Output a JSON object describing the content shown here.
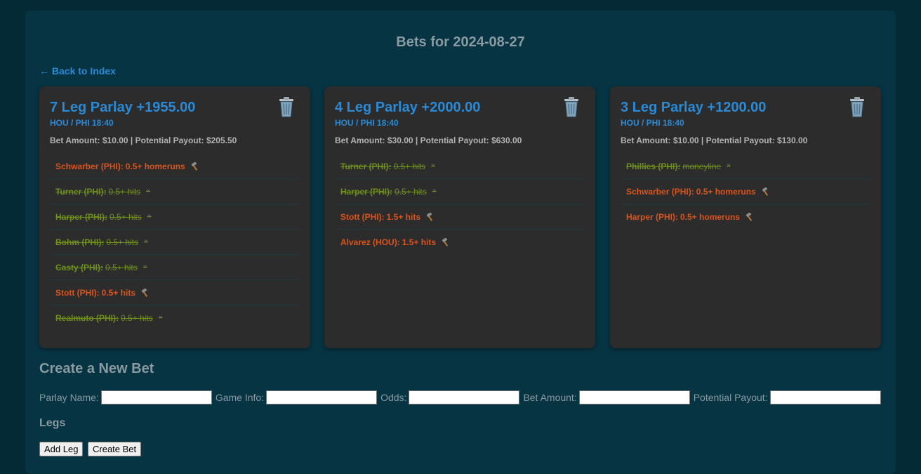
{
  "page": {
    "title": "Bets for 2024-08-27",
    "back_link": "← Back to Index"
  },
  "colors": {
    "accent": "#2a8ad6",
    "pending": "#d9541e",
    "won": "#6f8f1d",
    "card_bg": "#2c2c2c",
    "page_bg": "#063442"
  },
  "cards": [
    {
      "title": "7 Leg Parlay +1955.00",
      "game": "HOU / PHI 18:40",
      "amount": "Bet Amount: $10.00 | Potential Payout: $205.50",
      "legs": [
        {
          "player": "Schwarber (PHI):",
          "prop": "0.5+ homeruns",
          "status": "pending",
          "icon": "hammer-icon"
        },
        {
          "player": "Turner (PHI):",
          "prop": "0.5+ hits",
          "status": "won",
          "mark": "×"
        },
        {
          "player": "Harper (PHI):",
          "prop": "0.5+ hits",
          "status": "won",
          "mark": "×"
        },
        {
          "player": "Bohm (PHI):",
          "prop": "0.5+ hits",
          "status": "won",
          "mark": "×"
        },
        {
          "player": "Casty (PHI):",
          "prop": "0.5+ hits",
          "status": "won",
          "mark": "×"
        },
        {
          "player": "Stott (PHI):",
          "prop": "0.5+ hits",
          "status": "pending",
          "icon": "hammer-icon"
        },
        {
          "player": "Realmuto (PHI):",
          "prop": "0.5+ hits",
          "status": "won",
          "mark": "×"
        }
      ]
    },
    {
      "title": "4 Leg Parlay +2000.00",
      "game": "HOU / PHI 18:40",
      "amount": "Bet Amount: $30.00 | Potential Payout: $630.00",
      "legs": [
        {
          "player": "Turner (PHI):",
          "prop": "0.5+ hits",
          "status": "won",
          "mark": "×"
        },
        {
          "player": "Harper (PHI):",
          "prop": "0.5+ hits",
          "status": "won",
          "mark": "×"
        },
        {
          "player": "Stott (PHI):",
          "prop": "1.5+ hits",
          "status": "pending",
          "icon": "hammer-icon"
        },
        {
          "player": "Alvarez (HOU):",
          "prop": "1.5+ hits",
          "status": "pending",
          "icon": "hammer-icon"
        }
      ]
    },
    {
      "title": "3 Leg Parlay +1200.00",
      "game": "HOU / PHI 18:40",
      "amount": "Bet Amount: $10.00 | Potential Payout: $130.00",
      "legs": [
        {
          "player": "Phillies (PHI):",
          "prop": "moneyline",
          "status": "won",
          "mark": "×"
        },
        {
          "player": "Schwarber (PHI):",
          "prop": "0.5+ homeruns",
          "status": "pending",
          "icon": "hammer-icon"
        },
        {
          "player": "Harper (PHI):",
          "prop": "0.5+ homeruns",
          "status": "pending",
          "icon": "hammer-icon"
        }
      ]
    }
  ],
  "form": {
    "heading": "Create a New Bet",
    "parlay_name_label": "Parlay Name:",
    "game_info_label": "Game Info:",
    "odds_label": "Odds:",
    "bet_amount_label": "Bet Amount:",
    "potential_payout_label": "Potential Payout:",
    "legs_heading": "Legs",
    "add_leg_button": "Add Leg",
    "create_bet_button": "Create Bet"
  }
}
